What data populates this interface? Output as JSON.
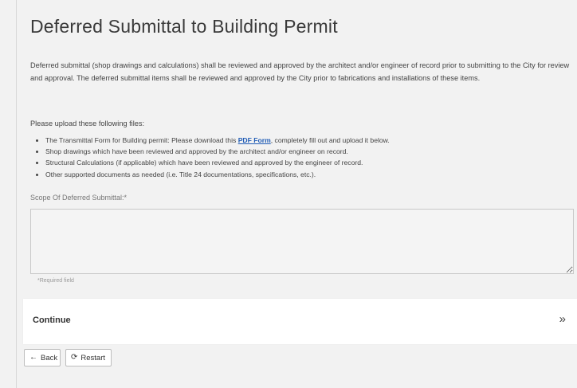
{
  "page": {
    "title": "Deferred Submittal to Building Permit",
    "intro": "Deferred submittal (shop drawings and calculations) shall be reviewed and approved by the architect and/or engineer of record prior to submitting to the City for review and approval. The deferred submittal items shall be reviewed and approved by the City prior to fabrications and installations of these items.",
    "upload_heading": "Please upload these following files:",
    "files": {
      "item1_before": "The Transmittal Form for Building permit: Please download this ",
      "item1_link": "PDF Form",
      "item1_after": ", completely fill out and upload it below.",
      "item2": "Shop drawings which have been reviewed and approved by the architect and/or engineer on record.",
      "item3": "Structural Calculations (if applicable) which have been reviewed and approved by the engineer of record.",
      "item4": "Other supported documents as needed (i.e. Title 24 documentations, specifications, etc.)."
    }
  },
  "form": {
    "scope_label": "Scope Of Deferred Submittal:*",
    "scope_value": "",
    "required_note": "*Required field"
  },
  "continue": {
    "label": "Continue",
    "icon": "»"
  },
  "buttons": {
    "back_icon": "←",
    "back_label": "Back",
    "restart_icon": "⟳",
    "restart_label": "Restart"
  },
  "colors": {
    "background": "#f2f2f2",
    "link": "#1f5bb5",
    "panel": "#ffffff"
  }
}
